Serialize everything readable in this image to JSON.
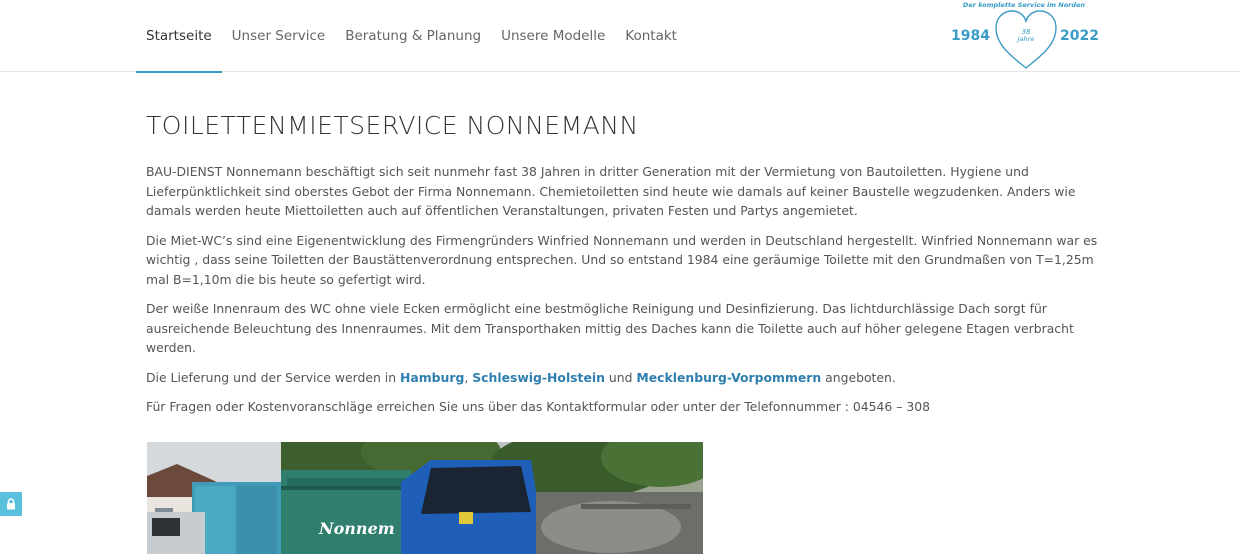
{
  "nav": {
    "items": [
      {
        "label": "Startseite",
        "active": true
      },
      {
        "label": "Unser Service",
        "active": false
      },
      {
        "label": "Beratung & Planung",
        "active": false
      },
      {
        "label": "Unsere Modelle",
        "active": false
      },
      {
        "label": "Kontakt",
        "active": false
      }
    ]
  },
  "logo": {
    "tagline": "Der komplette Service im Norden",
    "year_start": "1984",
    "years_number": "38",
    "years_word": "Jahre",
    "year_end": "2022",
    "color": "#3a9bc4"
  },
  "main": {
    "title": "TOILETTENMIETSERVICE NONNEMANN",
    "paragraph1": "BAU-DIENST Nonnemann beschäftigt sich seit nunmehr fast 38 Jahren in dritter Generation mit der Vermietung von Bautoiletten. Hygiene und Lieferpünktlichkeit sind oberstes Gebot der Firma Nonnemann. Chemietoiletten sind heute wie damals auf keiner Baustelle wegzudenken. Anders wie damals werden heute Miettoiletten auch auf öffentlichen Veranstaltungen, privaten Festen und Partys angemietet.",
    "paragraph2": "Die Miet-WC’s sind eine Eigenentwicklung des Firmengründers Winfried Nonnemann und werden in Deutschland hergestellt. Winfried Nonnemann war es wichtig , dass seine Toiletten der Baustättenverordnung entsprechen. Und so entstand 1984 eine geräumige Toilette mit den Grundmaßen von T=1,25m mal B=1,10m die bis heute so gefertigt wird.",
    "paragraph3": "Der weiße Innenraum des WC ohne viele Ecken ermöglicht eine bestmögliche Reinigung und Desinfizierung. Das lichtdurchlässige Dach sorgt für ausreichende Beleuchtung des Innenraumes. Mit dem Transporthaken mittig des Daches kann die Toilette auch auf höher gelegene Etagen verbracht werden.",
    "delivery": {
      "prefix": "Die Lieferung und der Service werden in ",
      "link1": "Hamburg",
      "sep1": ", ",
      "link2": "Schleswig-Holstein",
      "sep2": " und ",
      "link3": "Mecklenburg-Vorpommern",
      "suffix": " angeboten."
    },
    "paragraph5": "Für Fragen oder Kostenvoranschläge erreichen Sie uns über das Kontaktformular oder unter der Telefonnummer : 04546 – 308"
  },
  "gallery": {
    "truck_lettering": "Nonnem"
  },
  "colors": {
    "accent": "#3a9bc4",
    "link": "#2e7fb0",
    "lock_button": "#5bc0de"
  }
}
